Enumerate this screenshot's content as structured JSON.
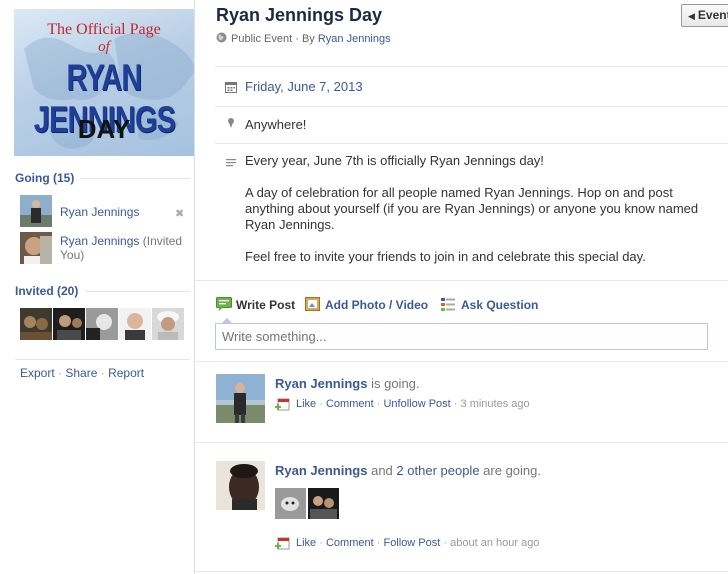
{
  "event": {
    "title": "Ryan Jennings Day",
    "privacy": "Public Event",
    "by_prefix": "· By",
    "host": "Ryan Jennings",
    "date": "Friday, June 7, 2013",
    "location": "Anywhere!",
    "description": [
      "Every year, June 7th is officially Ryan Jennings day!",
      "A day of celebration for all people named Ryan Jennings. Hop on and post anything about yourself (if you are Ryan Jennings) or anyone you know named Ryan Jennings.",
      "Feel free to invite your friends to join in and celebrate this special day."
    ],
    "photo_text": {
      "line1": "The Official Page",
      "line2": "of",
      "line3": "RYAN JENNINGS",
      "line4": "DAY"
    }
  },
  "header": {
    "events_button": "Event",
    "back_icon": "caret-left-icon"
  },
  "sidebar": {
    "going": {
      "heading": "Going (15)",
      "people": [
        {
          "name": "Ryan Jennings",
          "note": ""
        },
        {
          "name": "Ryan Jennings",
          "note": "(Invited You)"
        }
      ],
      "remove_icon": "remove-x-icon"
    },
    "invited": {
      "heading": "Invited (20)",
      "thumb_count": 5
    },
    "footer": {
      "export": "Export",
      "share": "Share",
      "report": "Report",
      "dot": "·"
    }
  },
  "composer": {
    "tabs": [
      {
        "label": "Write Post",
        "icon": "write-post-icon"
      },
      {
        "label": "Add Photo / Video",
        "icon": "add-photo-icon"
      },
      {
        "label": "Ask Question",
        "icon": "ask-question-icon"
      }
    ],
    "placeholder": "Write something..."
  },
  "stories": [
    {
      "actor": "Ryan Jennings",
      "connector": "",
      "others": "",
      "verb": "is going.",
      "actions": [
        "Like",
        "Comment",
        "Unfollow Post"
      ],
      "time": "3 minutes ago"
    },
    {
      "actor": "Ryan Jennings",
      "connector": "and",
      "others": "2 other people",
      "verb": "are going.",
      "actions": [
        "Like",
        "Comment",
        "Follow Post"
      ],
      "time": "about an hour ago"
    }
  ],
  "colors": {
    "link": "#3b5998",
    "title": "#1c2a47",
    "photo_red": "#c0282a",
    "photo_blue": "#1d3f97"
  }
}
